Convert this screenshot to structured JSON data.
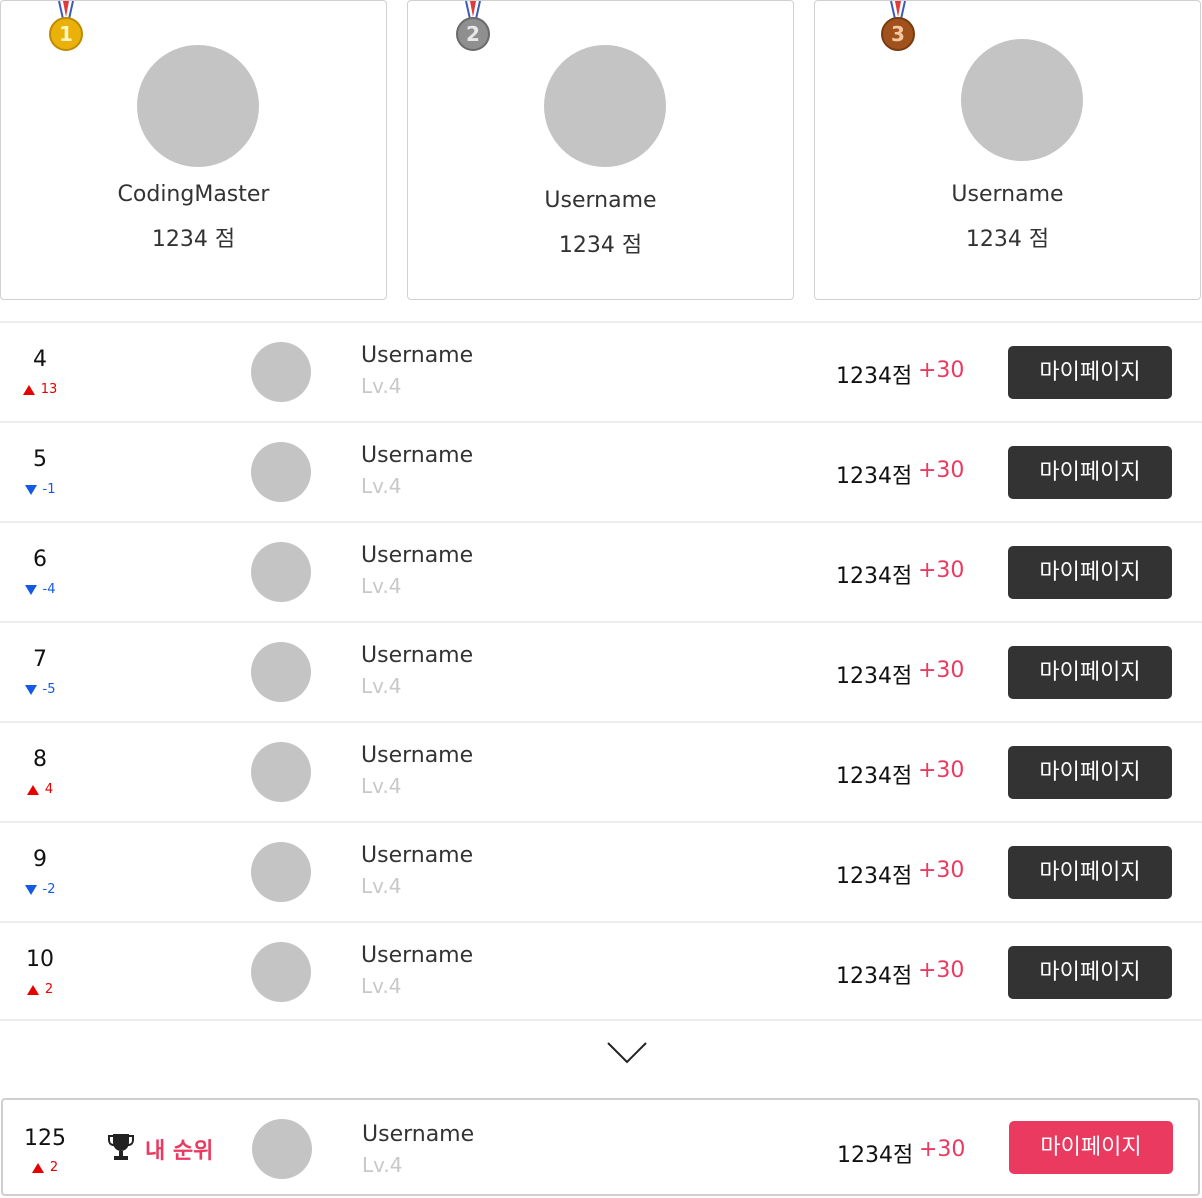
{
  "podium": [
    {
      "place": "1",
      "name": "CodingMaster",
      "score": "1234 점",
      "medal_color": "#e9b10a"
    },
    {
      "place": "2",
      "name": "Username",
      "score": "1234 점",
      "medal_color": "#8f8f8f"
    },
    {
      "place": "3",
      "name": "Username",
      "score": "1234 점",
      "medal_color": "#a1521c"
    }
  ],
  "rows": [
    {
      "rank": "4",
      "delta": "13",
      "dir": "up",
      "name": "Username",
      "level": "Lv.4",
      "points": "1234점",
      "gain": "+30",
      "button": "마이페이지"
    },
    {
      "rank": "5",
      "delta": "-1",
      "dir": "down",
      "name": "Username",
      "level": "Lv.4",
      "points": "1234점",
      "gain": "+30",
      "button": "마이페이지"
    },
    {
      "rank": "6",
      "delta": "-4",
      "dir": "down",
      "name": "Username",
      "level": "Lv.4",
      "points": "1234점",
      "gain": "+30",
      "button": "마이페이지"
    },
    {
      "rank": "7",
      "delta": "-5",
      "dir": "down",
      "name": "Username",
      "level": "Lv.4",
      "points": "1234점",
      "gain": "+30",
      "button": "마이페이지"
    },
    {
      "rank": "8",
      "delta": "4",
      "dir": "up",
      "name": "Username",
      "level": "Lv.4",
      "points": "1234점",
      "gain": "+30",
      "button": "마이페이지"
    },
    {
      "rank": "9",
      "delta": "-2",
      "dir": "down",
      "name": "Username",
      "level": "Lv.4",
      "points": "1234점",
      "gain": "+30",
      "button": "마이페이지"
    },
    {
      "rank": "10",
      "delta": "2",
      "dir": "up",
      "name": "Username",
      "level": "Lv.4",
      "points": "1234점",
      "gain": "+30",
      "button": "마이페이지"
    }
  ],
  "my_rank": {
    "rank": "125",
    "delta": "2",
    "dir": "up",
    "label": "내 순위",
    "name": "Username",
    "level": "Lv.4",
    "points": "1234점",
    "gain": "+30",
    "button": "마이페이지"
  },
  "icons": {
    "expand": "chevron-down-icon",
    "my_rank": "trophy-icon",
    "podium": "medal-icon"
  },
  "colors": {
    "accent": "#ea3a60",
    "button_dark": "#333333",
    "up": "#e60000",
    "down": "#1259e6",
    "avatar": "#c4c4c4"
  }
}
